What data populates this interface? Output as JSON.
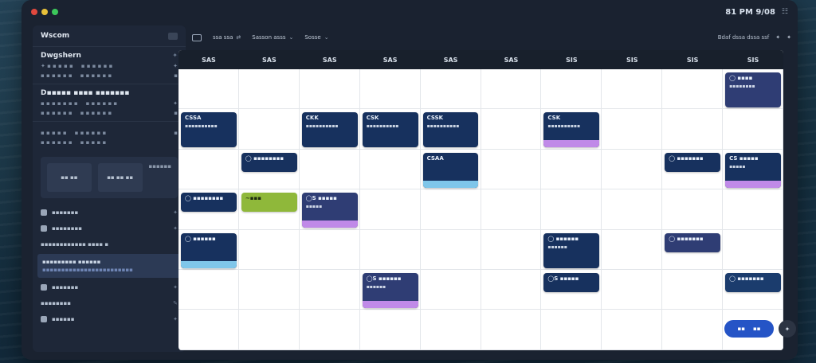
{
  "titlebar": {
    "time": "81 PM 9/08",
    "extra": "☷",
    "dot_colors": [
      "#e0483e",
      "#e8c13a",
      "#3cc85b"
    ]
  },
  "sidebar": {
    "header": "Wscom",
    "section1": {
      "title": "Dwgshern",
      "lines": [
        [
          "✦ ▪ ▪ ▪ ▪ ▪",
          "▪ ▪ ▪ ▪ ▪ ▪",
          "✦"
        ],
        [
          "▪ ▪ ▪ ▪ ▪ ▪",
          "▪ ▪ ▪ ▪ ▪ ▪",
          "▪"
        ]
      ]
    },
    "section2": {
      "title": "D▪▪▪▪▪ ▪▪▪▪  ▪▪▪▪▪▪▪",
      "lines": [
        [
          "▪ ▪ ▪ ▪ ▪ ▪ ▪",
          "▪ ▪ ▪ ▪ ▪ ▪",
          "✦"
        ],
        [
          "▪ ▪ ▪ ▪ ▪ ▪",
          "▪ ▪ ▪ ▪ ▪ ▪",
          "▪"
        ]
      ]
    },
    "section3": {
      "lines": [
        [
          "▪ ▪ ▪ ▪ ▪",
          "▪ ▪ ▪ ▪ ▪ ▪",
          "▪"
        ],
        [
          "▪ ▪ ▪ ▪ ▪ ▪",
          "▪ ▪ ▪ ▪ ▪",
          ""
        ]
      ]
    },
    "block": {
      "tile1": "▪▪ ▪▪",
      "tile2": "▪▪ ▪▪ ▪▪",
      "label": "▪▪▪▪▪▪"
    },
    "list": [
      {
        "label": "▪▪▪▪▪▪▪",
        "right": "✦"
      },
      {
        "label": "▪▪▪▪▪▪▪▪",
        "right": "✦"
      },
      {
        "label": "▪▪▪▪▪▪▪▪▪▪▪▪  ▪▪▪▪ ▪",
        "right": ""
      }
    ],
    "selected": {
      "label": "▪▪▪▪▪▪▪▪▪ ▪▪▪▪▪▪",
      "sub": "▪▪▪▪▪▪▪▪▪▪▪▪▪▪▪▪▪▪▪▪▪▪▪▪"
    },
    "list2": [
      {
        "label": "▪▪▪▪▪▪▪",
        "right": "✦"
      },
      {
        "label": "▪▪▪▪▪▪▪▪",
        "right": "✎"
      },
      {
        "label": "▪▪▪▪▪▪",
        "right": "✦"
      }
    ]
  },
  "toolbar": {
    "view": "ssa ssa",
    "sel1": "Sasson asss",
    "sel2": "Sosse",
    "right1": "Bdaf dssa dssa ssf",
    "right2": "✦",
    "right3": "✦"
  },
  "calendar": {
    "days": [
      "SAS",
      "SAS",
      "SAS",
      "SAS",
      "SAS",
      "SAS",
      "SIS",
      "SIS",
      "SIS",
      "SIS"
    ],
    "rows": [
      [
        "",
        "",
        "",
        "",
        "",
        "",
        "",
        "",
        "",
        ""
      ],
      [
        "",
        "",
        "",
        "",
        "",
        "",
        "",
        "",
        "",
        ""
      ],
      [
        "",
        "",
        "",
        "",
        "",
        "",
        "",
        "",
        "",
        ""
      ],
      [
        "",
        "",
        "",
        "",
        "",
        "",
        "",
        "",
        "",
        ""
      ],
      [
        "",
        "",
        "",
        "",
        "",
        "",
        "",
        "",
        "",
        ""
      ],
      [
        "",
        "",
        "",
        "",
        "",
        "",
        "",
        "",
        "",
        ""
      ],
      [
        "",
        "",
        "",
        "",
        "",
        "",
        "",
        "",
        "",
        ""
      ]
    ],
    "events": [
      {
        "title": "CSSA",
        "sub": "▪▪▪▪▪▪▪▪▪▪",
        "col": 0,
        "row": 1,
        "style": "navy",
        "bar": ""
      },
      {
        "title": "CKK",
        "sub": "▪▪▪▪▪▪▪▪▪▪",
        "col": 2,
        "row": 1,
        "style": "navy",
        "bar": ""
      },
      {
        "title": "CSK",
        "sub": "▪▪▪▪▪▪▪▪▪▪",
        "col": 3,
        "row": 1,
        "style": "navy",
        "bar": ""
      },
      {
        "title": "CSSK",
        "sub": "▪▪▪▪▪▪▪▪▪▪",
        "col": 4,
        "row": 1,
        "style": "navy",
        "bar": ""
      },
      {
        "title": "CSK",
        "sub": "▪▪▪▪▪▪▪▪▪▪",
        "col": 6,
        "row": 1,
        "style": "navy",
        "bar": "#c08ae8"
      },
      {
        "title": "◯ ▪▪▪▪",
        "sub": "▪▪▪▪▪▪▪▪",
        "col": 9,
        "row": 0,
        "style": "indigo",
        "bar": ""
      },
      {
        "title": "◯ ▪▪▪▪▪▪▪▪",
        "sub": "",
        "col": 1,
        "row": 2,
        "style": "navy",
        "bar": ""
      },
      {
        "title": "CSAA",
        "sub": "",
        "col": 4,
        "row": 2,
        "style": "navy",
        "bar": "#7fc6ea"
      },
      {
        "title": "◯ ▪▪▪▪▪▪▪",
        "sub": "",
        "col": 8,
        "row": 2,
        "style": "navy",
        "bar": ""
      },
      {
        "title": "CS ▪▪▪▪▪",
        "sub": "▪▪▪▪▪",
        "col": 9,
        "row": 2,
        "style": "navy",
        "bar": "#c08ae8"
      },
      {
        "title": "◯ ▪▪▪▪▪▪▪▪",
        "sub": "",
        "col": 0,
        "row": 3,
        "style": "navy",
        "bar": ""
      },
      {
        "title": "~▪▪▪",
        "sub": "",
        "col": 1,
        "row": 3,
        "style": "green",
        "bar": ""
      },
      {
        "title": "◯S ▪▪▪▪▪",
        "sub": "▪▪▪▪▪",
        "col": 2,
        "row": 3,
        "style": "indigo",
        "bar": "#c08ae8"
      },
      {
        "title": "◯ ▪▪▪▪▪▪",
        "sub": "",
        "col": 0,
        "row": 4,
        "style": "navy",
        "bar": "#7fc6ea"
      },
      {
        "title": "◯ ▪▪▪▪▪▪",
        "sub": "▪▪▪▪▪▪",
        "col": 6,
        "row": 4,
        "style": "navy",
        "bar": ""
      },
      {
        "title": "◯ ▪▪▪▪▪▪▪",
        "sub": "",
        "col": 8,
        "row": 4,
        "style": "indigo",
        "bar": ""
      },
      {
        "title": "◯S ▪▪▪▪▪▪",
        "sub": "▪▪▪▪▪▪",
        "col": 3,
        "row": 5,
        "style": "indigo",
        "bar": "#c08ae8"
      },
      {
        "title": "◯S ▪▪▪▪▪",
        "sub": "",
        "col": 6,
        "row": 5,
        "style": "navy",
        "bar": ""
      },
      {
        "title": "◯ ▪▪▪▪▪▪▪",
        "sub": "",
        "col": 9,
        "row": 5,
        "style": "blue",
        "bar": ""
      }
    ]
  },
  "fab": {
    "label1": "▪▪",
    "label2": "▪▪",
    "single": "✦"
  }
}
